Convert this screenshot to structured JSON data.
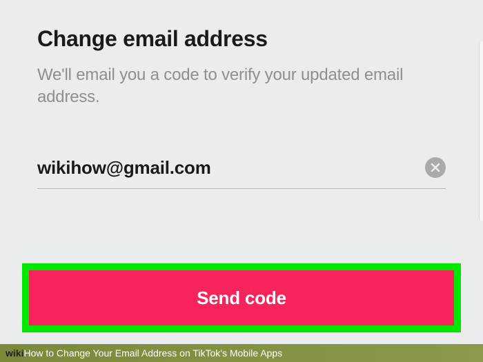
{
  "page": {
    "title": "Change email address",
    "subtitle": "We'll email you a code to verify your updated email address."
  },
  "form": {
    "email_value": "wikihow@gmail.com",
    "send_button_label": "Send code"
  },
  "footer": {
    "brand": "wiki",
    "caption": "How to Change Your Email Address on TikTok's Mobile Apps"
  }
}
